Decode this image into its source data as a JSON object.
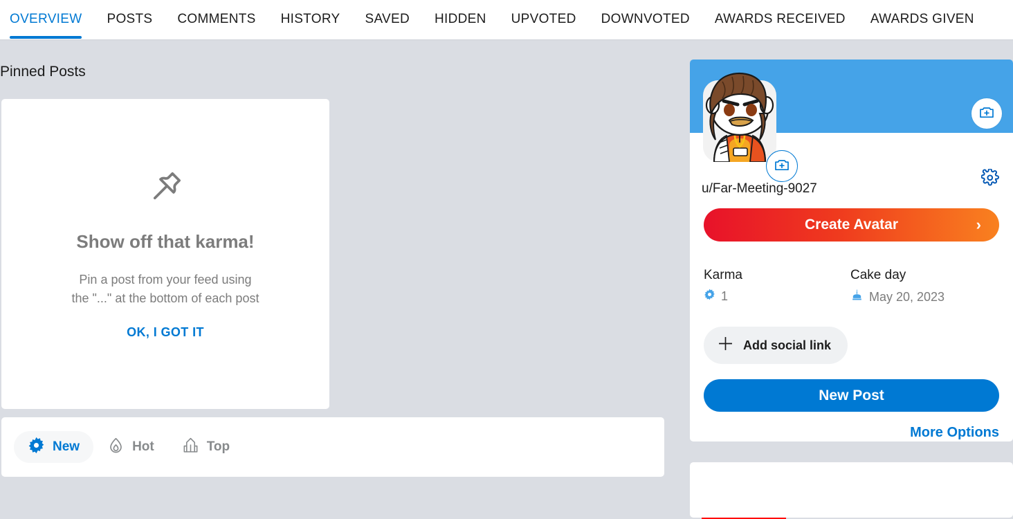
{
  "tabs": [
    {
      "label": "OVERVIEW",
      "active": true
    },
    {
      "label": "POSTS",
      "active": false
    },
    {
      "label": "COMMENTS",
      "active": false
    },
    {
      "label": "HISTORY",
      "active": false
    },
    {
      "label": "SAVED",
      "active": false
    },
    {
      "label": "HIDDEN",
      "active": false
    },
    {
      "label": "UPVOTED",
      "active": false
    },
    {
      "label": "DOWNVOTED",
      "active": false
    },
    {
      "label": "AWARDS RECEIVED",
      "active": false
    },
    {
      "label": "AWARDS GIVEN",
      "active": false
    }
  ],
  "main": {
    "section_title": "Pinned Posts",
    "pinned_card": {
      "icon": "pin-icon",
      "heading": "Show off that karma!",
      "subtext_line1": "Pin a post from your feed using",
      "subtext_line2": "the \"...\" at the bottom of each post",
      "cta_label": "OK, I GOT IT"
    },
    "sort_bar": {
      "options": [
        {
          "label": "New",
          "icon": "starburst-icon",
          "active": true
        },
        {
          "label": "Hot",
          "icon": "flame-icon",
          "active": false
        },
        {
          "label": "Top",
          "icon": "podium-icon",
          "active": false
        }
      ]
    }
  },
  "sidebar": {
    "profile_card": {
      "banner_color": "#45a3e8",
      "banner_camera_icon": "camera-plus-icon",
      "avatar_camera_icon": "camera-plus-icon",
      "avatar_alt": "snoo-avatar",
      "username": "u/Far-Meeting-9027",
      "settings_icon": "gear-icon",
      "create_avatar_label": "Create Avatar",
      "create_avatar_chevron": "›",
      "stats": [
        {
          "label": "Karma",
          "value": "1",
          "icon": "karma-starburst-icon",
          "highlighted": true
        },
        {
          "label": "Cake day",
          "value": "May 20, 2023",
          "icon": "cake-icon",
          "highlighted": false
        }
      ],
      "add_social_label": "Add social link",
      "add_social_icon": "plus-icon",
      "new_post_label": "New Post",
      "more_options_label": "More Options"
    }
  },
  "colors": {
    "accent_blue": "#0079d3",
    "banner_blue": "#45a3e8",
    "page_bg": "#dadde3",
    "card_bg": "#ffffff",
    "muted_text": "#7c7c7c",
    "highlight_red": "#ff0000"
  }
}
